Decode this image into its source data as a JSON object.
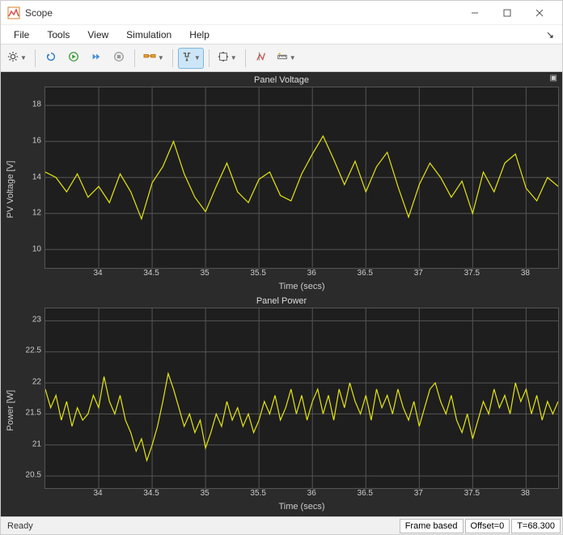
{
  "window": {
    "title": "Scope"
  },
  "menus": [
    "File",
    "Tools",
    "View",
    "Simulation",
    "Help"
  ],
  "toolbar": {
    "icons": [
      {
        "name": "gear-icon",
        "dropdown": true
      },
      {
        "sep": true
      },
      {
        "name": "restart-icon"
      },
      {
        "name": "run-icon"
      },
      {
        "name": "step-icon"
      },
      {
        "name": "stop-icon"
      },
      {
        "sep": true
      },
      {
        "name": "highlight-icon",
        "dropdown": true
      },
      {
        "sep": true
      },
      {
        "name": "trigger-icon",
        "dropdown": true,
        "active": true
      },
      {
        "sep": true
      },
      {
        "name": "zoom-icon",
        "dropdown": true
      },
      {
        "sep": true
      },
      {
        "name": "cursor-icon"
      },
      {
        "name": "measure-icon",
        "dropdown": true
      }
    ]
  },
  "status": {
    "ready": "Ready",
    "frame": "Frame based",
    "offset": "Offset=0",
    "time": "T=68.300"
  },
  "chart_data": [
    {
      "type": "line",
      "title": "Panel Voltage",
      "xlabel": "Time (secs)",
      "ylabel": "PV Voltage [V]",
      "xlim": [
        33.5,
        38.3
      ],
      "ylim": [
        9,
        19
      ],
      "xticks": [
        34,
        34.5,
        35,
        35.5,
        36,
        36.5,
        37,
        37.5,
        38
      ],
      "yticks": [
        10,
        12,
        14,
        16,
        18
      ],
      "x": [
        33.5,
        33.6,
        33.7,
        33.8,
        33.9,
        34.0,
        34.1,
        34.2,
        34.3,
        34.4,
        34.5,
        34.6,
        34.7,
        34.8,
        34.9,
        35.0,
        35.1,
        35.2,
        35.3,
        35.4,
        35.5,
        35.6,
        35.7,
        35.8,
        35.9,
        36.0,
        36.1,
        36.2,
        36.3,
        36.4,
        36.5,
        36.6,
        36.7,
        36.8,
        36.9,
        37.0,
        37.1,
        37.2,
        37.3,
        37.4,
        37.5,
        37.6,
        37.7,
        37.8,
        37.9,
        38.0,
        38.1,
        38.2,
        38.3
      ],
      "values": [
        14.3,
        14.0,
        13.2,
        14.2,
        12.9,
        13.5,
        12.6,
        14.2,
        13.2,
        11.7,
        13.7,
        14.6,
        16.0,
        14.2,
        12.9,
        12.1,
        13.5,
        14.8,
        13.2,
        12.6,
        13.9,
        14.3,
        13.0,
        12.7,
        14.2,
        15.3,
        16.3,
        15.0,
        13.6,
        14.9,
        13.2,
        14.6,
        15.4,
        13.5,
        11.8,
        13.6,
        14.8,
        14.0,
        12.9,
        13.8,
        12.0,
        14.3,
        13.2,
        14.8,
        15.3,
        13.4,
        12.7,
        14.0,
        13.5
      ]
    },
    {
      "type": "line",
      "title": "Panel Power",
      "xlabel": "Time (secs)",
      "ylabel": "Power [W]",
      "xlim": [
        33.5,
        38.3
      ],
      "ylim": [
        20.3,
        23.2
      ],
      "xticks": [
        34,
        34.5,
        35,
        35.5,
        36,
        36.5,
        37,
        37.5,
        38
      ],
      "yticks": [
        20.5,
        21,
        21.5,
        22,
        22.5,
        23
      ],
      "x": [
        33.5,
        33.55,
        33.6,
        33.65,
        33.7,
        33.75,
        33.8,
        33.85,
        33.9,
        33.95,
        34.0,
        34.05,
        34.1,
        34.15,
        34.2,
        34.25,
        34.3,
        34.35,
        34.4,
        34.45,
        34.5,
        34.55,
        34.6,
        34.65,
        34.7,
        34.75,
        34.8,
        34.85,
        34.9,
        34.95,
        35.0,
        35.05,
        35.1,
        35.15,
        35.2,
        35.25,
        35.3,
        35.35,
        35.4,
        35.45,
        35.5,
        35.55,
        35.6,
        35.65,
        35.7,
        35.75,
        35.8,
        35.85,
        35.9,
        35.95,
        36.0,
        36.05,
        36.1,
        36.15,
        36.2,
        36.25,
        36.3,
        36.35,
        36.4,
        36.45,
        36.5,
        36.55,
        36.6,
        36.65,
        36.7,
        36.75,
        36.8,
        36.85,
        36.9,
        36.95,
        37.0,
        37.05,
        37.1,
        37.15,
        37.2,
        37.25,
        37.3,
        37.35,
        37.4,
        37.45,
        37.5,
        37.55,
        37.6,
        37.65,
        37.7,
        37.75,
        37.8,
        37.85,
        37.9,
        37.95,
        38.0,
        38.05,
        38.1,
        38.15,
        38.2,
        38.25,
        38.3
      ],
      "values": [
        21.9,
        21.6,
        21.8,
        21.4,
        21.7,
        21.3,
        21.6,
        21.4,
        21.5,
        21.8,
        21.6,
        22.1,
        21.7,
        21.5,
        21.8,
        21.4,
        21.2,
        20.9,
        21.1,
        20.75,
        21.0,
        21.3,
        21.7,
        22.15,
        21.9,
        21.6,
        21.3,
        21.5,
        21.2,
        21.4,
        20.95,
        21.2,
        21.5,
        21.3,
        21.7,
        21.4,
        21.6,
        21.3,
        21.5,
        21.2,
        21.4,
        21.7,
        21.5,
        21.8,
        21.4,
        21.6,
        21.9,
        21.5,
        21.8,
        21.4,
        21.7,
        21.9,
        21.5,
        21.8,
        21.4,
        21.9,
        21.6,
        22.0,
        21.7,
        21.5,
        21.8,
        21.4,
        21.9,
        21.6,
        21.8,
        21.5,
        21.9,
        21.6,
        21.4,
        21.7,
        21.3,
        21.6,
        21.9,
        22.0,
        21.7,
        21.5,
        21.8,
        21.4,
        21.2,
        21.5,
        21.1,
        21.4,
        21.7,
        21.5,
        21.9,
        21.6,
        21.8,
        21.5,
        22.0,
        21.7,
        21.9,
        21.5,
        21.8,
        21.4,
        21.7,
        21.5,
        21.7
      ]
    }
  ]
}
